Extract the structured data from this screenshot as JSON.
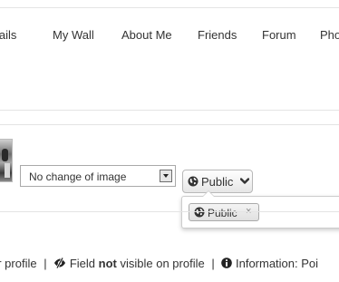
{
  "nav": {
    "items": [
      "etails",
      "My Wall",
      "About Me",
      "Friends",
      "Forum",
      "Pho"
    ]
  },
  "profile_image": {
    "select_value": "No change of image"
  },
  "privacy": {
    "button_label": "Public",
    "selected_tag": "Public",
    "remove_symbol": "×"
  },
  "legend": {
    "part1": "ur profile",
    "separator": "|",
    "not_visible_prefix": "Field",
    "not_visible_bold": "not",
    "not_visible_suffix": "visible on profile",
    "information_label": "Information: Poi"
  },
  "icons": {
    "globe": "globe-icon",
    "chevron": "chevron-down-icon",
    "eye_slash": "eye-slash-icon",
    "info": "info-circle-icon",
    "remove": "close-icon"
  },
  "colors": {
    "text": "#333333",
    "border": "#cccccc",
    "rule": "#e4e4e4"
  }
}
